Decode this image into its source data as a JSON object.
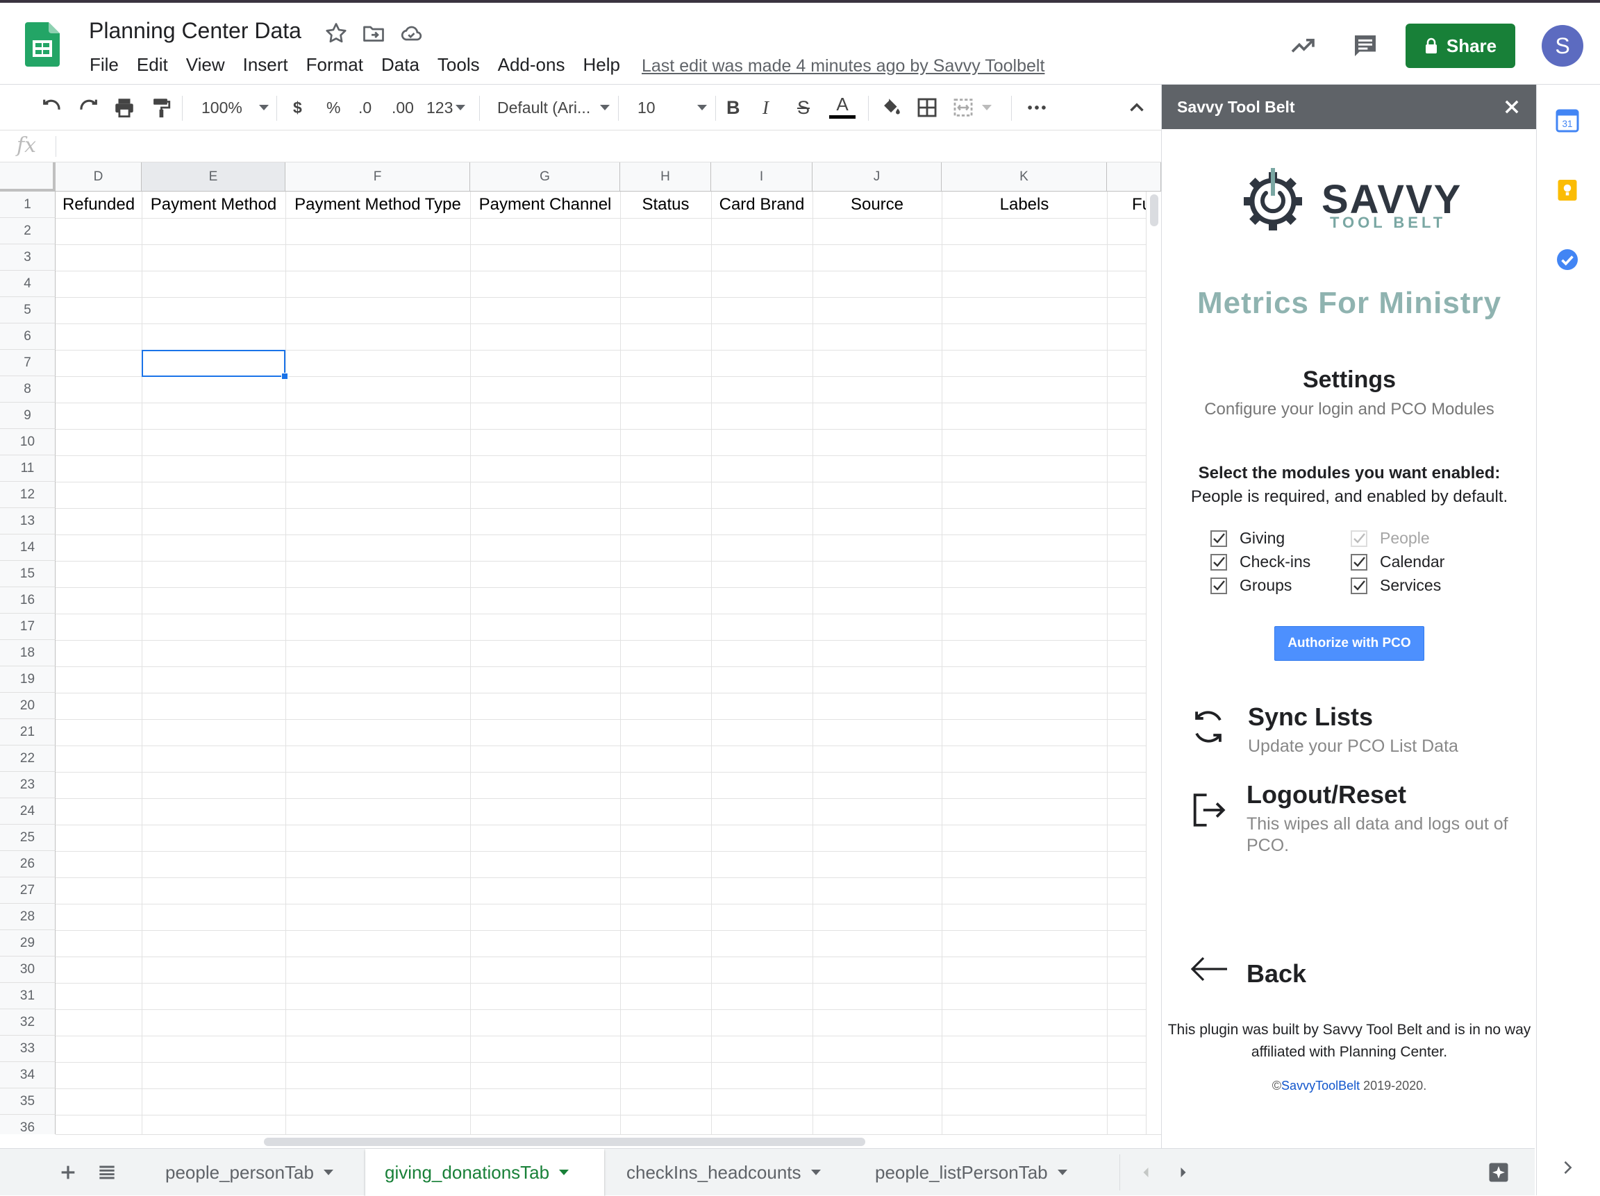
{
  "header": {
    "doc_title": "Planning Center Data",
    "menus": [
      "File",
      "Edit",
      "View",
      "Insert",
      "Format",
      "Data",
      "Tools",
      "Add-ons",
      "Help"
    ],
    "last_edit": "Last edit was made 4 minutes ago by Savvy Toolbelt",
    "share_label": "Share",
    "avatar_initial": "S"
  },
  "toolbar": {
    "zoom": "100%",
    "currency": "$",
    "percent": "%",
    "dec_decrease": ".0",
    "dec_increase": ".00",
    "more_formats": "123",
    "font": "Default (Ari...",
    "font_size": "10",
    "bold": "B",
    "italic": "I",
    "strike": "S",
    "text_color": "A"
  },
  "formula_bar": {
    "fx": "fx"
  },
  "grid": {
    "columns": [
      "D",
      "E",
      "F",
      "G",
      "H",
      "I",
      "J",
      "K",
      ""
    ],
    "header_row": [
      "Refunded",
      "Payment Method",
      "Payment Method Type",
      "Payment Channel",
      "Status",
      "Card Brand",
      "Source",
      "Labels",
      "Fu"
    ],
    "rows": [
      "1",
      "2",
      "3",
      "4",
      "5",
      "6",
      "7",
      "8",
      "9",
      "10",
      "11",
      "12",
      "13",
      "14",
      "15",
      "16",
      "17",
      "18",
      "19",
      "20",
      "21",
      "22",
      "23",
      "24",
      "25",
      "26",
      "27",
      "28",
      "29",
      "30",
      "31",
      "32",
      "33",
      "34",
      "35",
      "36"
    ],
    "selected_cell": "E7"
  },
  "tabs": [
    "people_personTab",
    "giving_donationsTab",
    "checkIns_headcounts",
    "people_listPersonTab"
  ],
  "active_tab": "giving_donationsTab",
  "sidepanel": {
    "title": "Savvy Tool Belt",
    "logo_word": "SAVVY",
    "logo_sub": "TOOL BELT",
    "app_title": "Metrics For Ministry",
    "settings_title": "Settings",
    "settings_sub": "Configure your login and PCO Modules",
    "select_heading": "Select the modules you want enabled:",
    "select_sub": "People is required, and enabled by default.",
    "modules": {
      "giving": "Giving",
      "checkins": "Check-ins",
      "groups": "Groups",
      "people": "People",
      "calendar": "Calendar",
      "services": "Services"
    },
    "authorize_label": "Authorize with PCO",
    "sync_title": "Sync Lists",
    "sync_sub": "Update your PCO List Data",
    "logout_title": "Logout/Reset",
    "logout_sub": "This wipes all data and logs out of PCO.",
    "back_label": "Back",
    "footer": "This plugin was built by Savvy Tool Belt and is in no way affiliated with Planning Center.",
    "copyright_symbol": "©",
    "copyright_link": "SavvyToolBelt",
    "copyright_years": " 2019-2020."
  },
  "colors": {
    "brand_green": "#188038",
    "selection_blue": "#1a73e8",
    "panel_header": "#5f6368",
    "app_title_teal": "#8fb3b0",
    "auth_button": "#4d90fe"
  }
}
